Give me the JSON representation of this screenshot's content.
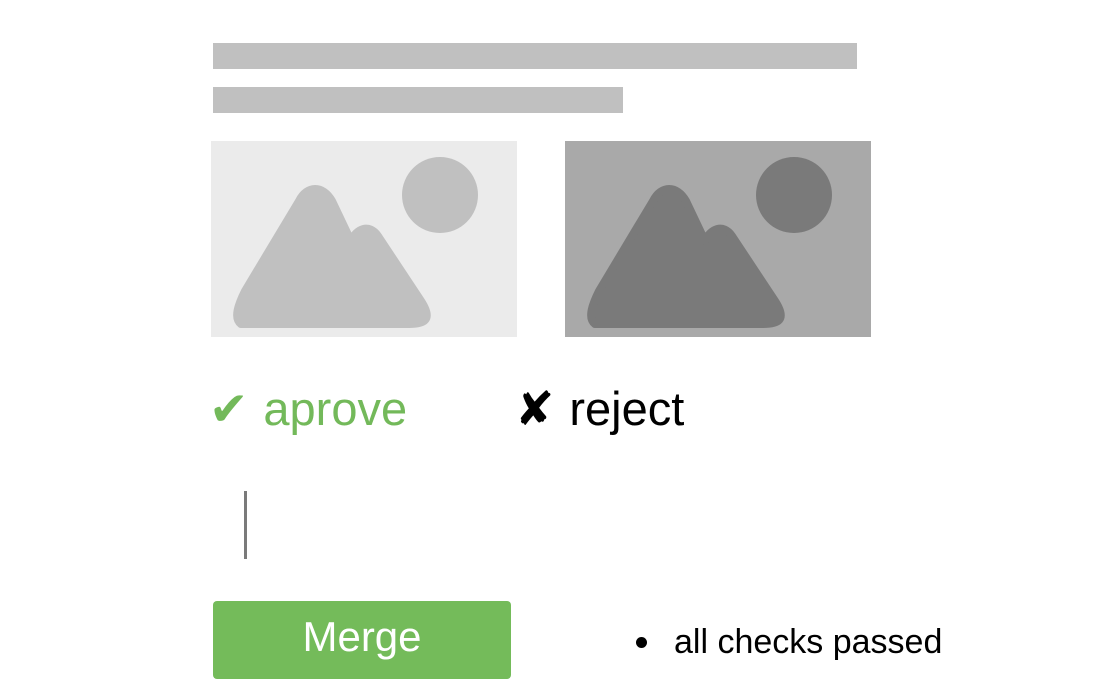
{
  "colors": {
    "approve": "#73b95a",
    "merge_button": "#74bb5a",
    "placeholder": "#c0c0c0",
    "image_light_bg": "#ebebeb",
    "image_dark_bg": "#a9a9a9"
  },
  "images": [
    {
      "icon": "image-placeholder-icon",
      "state": "unselected"
    },
    {
      "icon": "image-placeholder-icon",
      "state": "selected"
    }
  ],
  "review": {
    "approve_icon": "✔",
    "approve_label": "aprove",
    "reject_icon": "✘",
    "reject_label": "reject"
  },
  "merge": {
    "label": "Merge"
  },
  "status": {
    "text": "all checks passed"
  }
}
